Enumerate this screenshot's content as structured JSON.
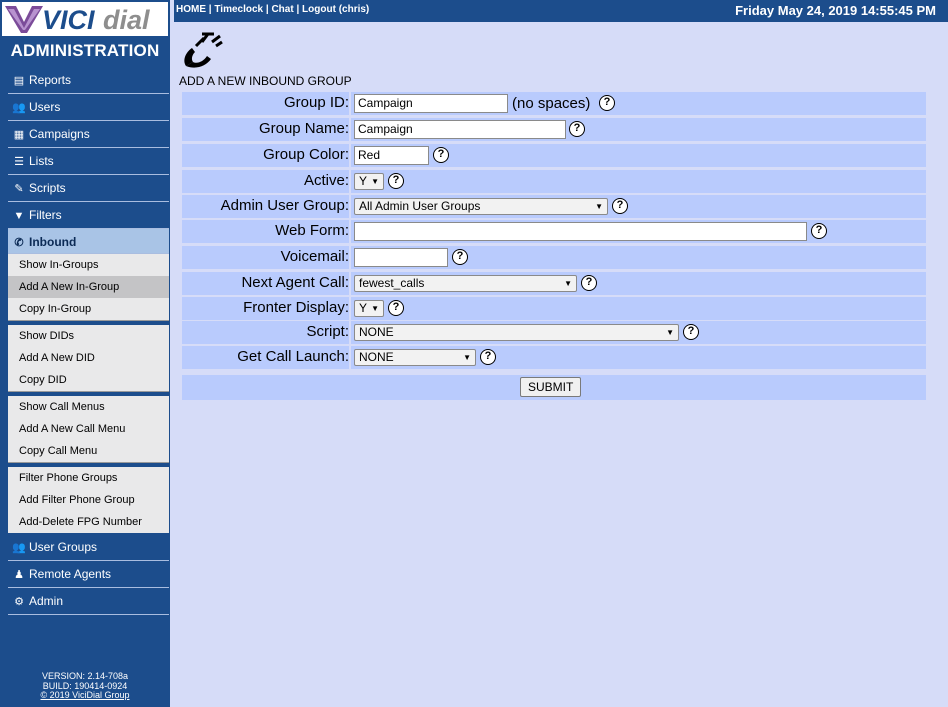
{
  "brand": {
    "logo_text": "VICIdial",
    "admin_title": "ADMINISTRATION"
  },
  "topbar": {
    "links": [
      "HOME",
      "Timeclock",
      "Chat",
      "Logout (chris)"
    ],
    "datetime": "Friday May 24, 2019 14:55:45 PM"
  },
  "sidebar": {
    "reports": "Reports",
    "users": "Users",
    "campaigns": "Campaigns",
    "lists": "Lists",
    "scripts": "Scripts",
    "filters": "Filters",
    "inbound": "Inbound",
    "inbound_sub": [
      "Show In-Groups",
      "Add A New In-Group",
      "Copy In-Group",
      "Show DIDs",
      "Add A New DID",
      "Copy DID",
      "Show Call Menus",
      "Add A New Call Menu",
      "Copy Call Menu",
      "Filter Phone Groups",
      "Add Filter Phone Group",
      "Add-Delete FPG Number"
    ],
    "user_groups": "User Groups",
    "remote_agents": "Remote Agents",
    "admin": "Admin",
    "version": "VERSION: 2.14-708a",
    "build": "BUILD: 190414-0924",
    "copyright": "© 2019 ViciDial Group"
  },
  "form": {
    "heading": "ADD A NEW INBOUND GROUP",
    "group_id_label": "Group ID:",
    "group_id_value": "Campaign",
    "group_id_note": "(no spaces)",
    "group_name_label": "Group Name:",
    "group_name_value": "Campaign",
    "group_color_label": "Group Color:",
    "group_color_value": "Red",
    "active_label": "Active:",
    "active_value": "Y",
    "admin_user_group_label": "Admin User Group:",
    "admin_user_group_value": "All Admin User Groups",
    "web_form_label": "Web Form:",
    "web_form_value": "",
    "voicemail_label": "Voicemail:",
    "voicemail_value": "",
    "next_agent_call_label": "Next Agent Call:",
    "next_agent_call_value": "fewest_calls",
    "fronter_display_label": "Fronter Display:",
    "fronter_display_value": "Y",
    "script_label": "Script:",
    "script_value": "NONE",
    "get_call_launch_label": "Get Call Launch:",
    "get_call_launch_value": "NONE",
    "help_glyph": "?",
    "submit_label": "SUBMIT"
  }
}
